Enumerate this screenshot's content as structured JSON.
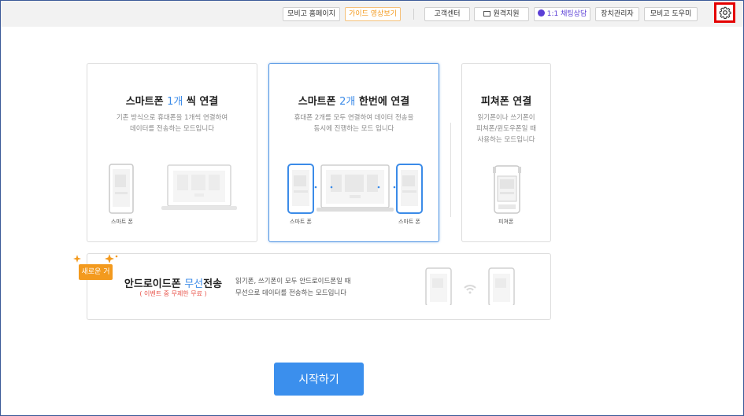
{
  "topbar": {
    "mobile_homepage": "모비고 홈페이지",
    "guide_video": "가이드 영상보기",
    "customer_center": "고객센터",
    "remote_support": "원격지원",
    "chat_consult": "1:1 채팅상담",
    "device_manager": "장치관리자",
    "mobigo_help": "모비고 도우미"
  },
  "cards": {
    "single": {
      "title_pre": "스마트폰 ",
      "title_hl": "1개",
      "title_post": " 씩 연결",
      "desc1": "기존 방식으로 휴대폰을 1개씩 연결하여",
      "desc2": "데이터를 전송하는 모드입니다",
      "label_phone": "스마트 폰"
    },
    "dual": {
      "title_pre": "스마트폰 ",
      "title_hl": "2개",
      "title_post": " 한번에 연결",
      "desc1": "휴대폰 2개를 모두 연결하여 데이터 전송을",
      "desc2": "동시에 진행하는 모드 입니다",
      "label_left": "스마트 폰",
      "label_right": "스마트 폰"
    },
    "feature": {
      "title": "피쳐폰 연결",
      "desc1": "읽기폰이나 쓰기폰이",
      "desc2": "피쳐폰/윈도우폰일 때",
      "desc3": "사용하는 모드입니다",
      "label_phone": "피쳐폰"
    },
    "wireless": {
      "badge": "새로운 거",
      "title_pre": "안드로이드폰 ",
      "title_hl": "무선",
      "title_post": "전송",
      "event": "( 이벤트 중 무제한 무료 )",
      "desc1": "읽기폰, 쓰기폰이 모두 안드로이드폰일 때",
      "desc2": "무선으로 데이터를 전송하는 모드입니다"
    }
  },
  "start_button": "시작하기",
  "colors": {
    "accent": "#3b8fed",
    "highlight": "#3b8be8",
    "orange": "#f39a1e",
    "event_red": "#e8534a",
    "purple": "#5b3fd6"
  }
}
